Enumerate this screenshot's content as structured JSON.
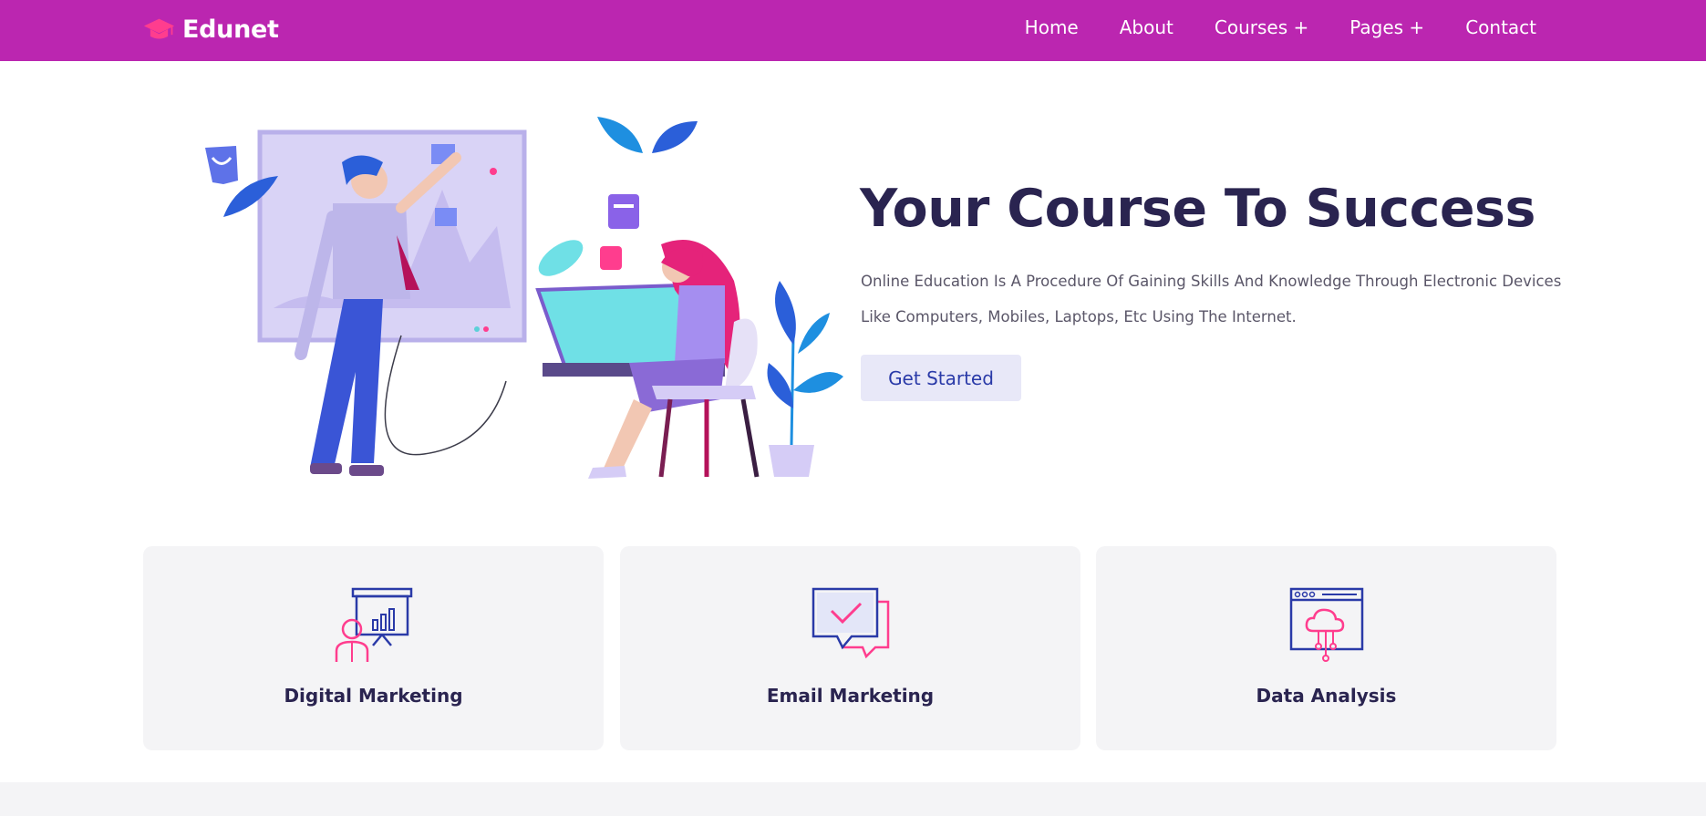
{
  "brand": {
    "name": "Edunet",
    "icon": "graduation-cap-icon",
    "color": "#bb26b0",
    "icon_color": "#ff3d8e"
  },
  "nav": {
    "items": [
      {
        "label": "Home"
      },
      {
        "label": "About"
      },
      {
        "label": "Courses +"
      },
      {
        "label": "Pages +"
      },
      {
        "label": "Contact"
      }
    ]
  },
  "hero": {
    "title": "Your Course To Success",
    "description": "Online Education Is A Procedure Of Gaining Skills And Knowledge Through Electronic Devices Like Computers, Mobiles, Laptops, Etc Using The Internet.",
    "button_label": "Get Started",
    "illustration": "students-whiteboard-drawing-desk-illustration"
  },
  "cards": [
    {
      "title": "Digital Marketing",
      "icon": "presentation-chart-icon"
    },
    {
      "title": "Email Marketing",
      "icon": "chat-check-icon"
    },
    {
      "title": "Data Analysis",
      "icon": "cloud-browser-icon"
    }
  ],
  "colors": {
    "accent_blue": "#2a3aa8",
    "accent_pink": "#ff3d8e",
    "heading": "#2a2450"
  }
}
